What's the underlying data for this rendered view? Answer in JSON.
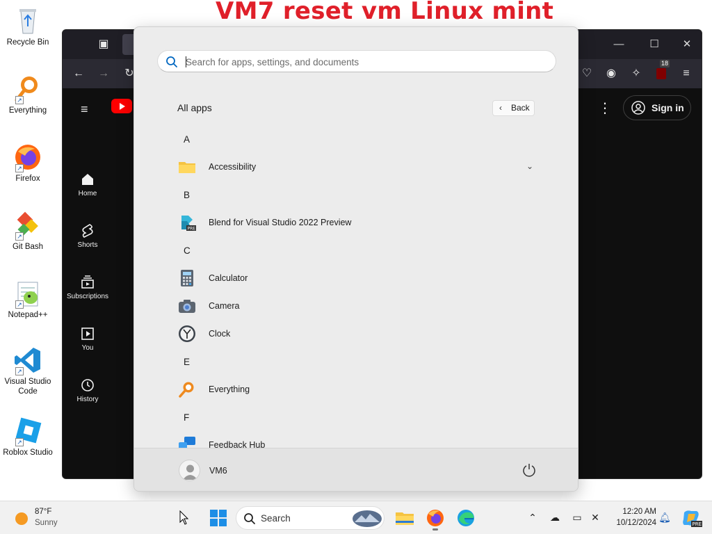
{
  "overlay": {
    "title": "VM7 reset vm Linux mint"
  },
  "desktop": {
    "icons": [
      {
        "label": "Recycle Bin",
        "icon": "recycle-bin-icon"
      },
      {
        "label": "Everything",
        "icon": "everything-icon"
      },
      {
        "label": "Firefox",
        "icon": "firefox-icon"
      },
      {
        "label": "Git Bash",
        "icon": "git-bash-icon"
      },
      {
        "label": "Notepad++",
        "icon": "notepadpp-icon"
      },
      {
        "label": "Visual Studio Code",
        "icon": "vscode-icon"
      },
      {
        "label": "Roblox Studio",
        "icon": "roblox-studio-icon"
      }
    ]
  },
  "browser": {
    "extension_badge": "18",
    "youtube": {
      "nav": [
        {
          "label": "Home",
          "icon": "home-icon"
        },
        {
          "label": "Shorts",
          "icon": "shorts-icon"
        },
        {
          "label": "Subscriptions",
          "icon": "subscriptions-icon"
        },
        {
          "label": "You",
          "icon": "you-icon"
        },
        {
          "label": "History",
          "icon": "history-icon"
        }
      ],
      "sign_in": "Sign in"
    }
  },
  "start_menu": {
    "search_placeholder": "Search for apps, settings, and documents",
    "section_title": "All apps",
    "back_label": "Back",
    "groups": [
      {
        "letter": "A",
        "apps": [
          {
            "name": "Accessibility",
            "icon": "folder-icon",
            "expandable": true
          }
        ]
      },
      {
        "letter": "B",
        "apps": [
          {
            "name": "Blend for Visual Studio 2022 Preview",
            "icon": "blend-icon"
          }
        ]
      },
      {
        "letter": "C",
        "apps": [
          {
            "name": "Calculator",
            "icon": "calculator-icon"
          },
          {
            "name": "Camera",
            "icon": "camera-icon"
          },
          {
            "name": "Clock",
            "icon": "clock-icon"
          }
        ]
      },
      {
        "letter": "E",
        "apps": [
          {
            "name": "Everything",
            "icon": "everything-icon"
          }
        ]
      },
      {
        "letter": "F",
        "apps": [
          {
            "name": "Feedback Hub",
            "icon": "feedback-hub-icon"
          }
        ]
      }
    ],
    "user": "VM6"
  },
  "taskbar": {
    "weather_temp": "87°F",
    "weather_cond": "Sunny",
    "search_label": "Search",
    "time": "12:20 AM",
    "date": "10/12/2024"
  },
  "colors": {
    "overlay_red": "#e0202a",
    "youtube_red": "#ff0000",
    "win_blue": "#0067c0"
  }
}
